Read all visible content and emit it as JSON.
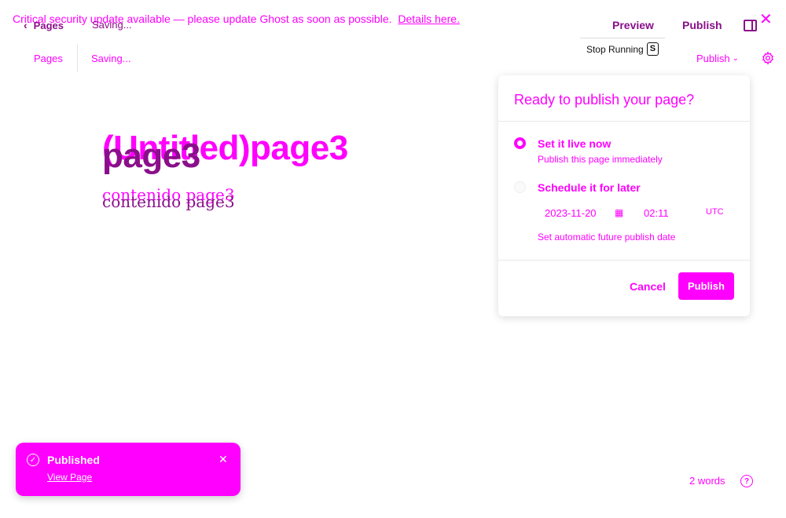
{
  "banner": {
    "text": "Critical security update available — please update Ghost as soon as possible.",
    "link": "Details here."
  },
  "overlay_header": {
    "back_label": "Pages",
    "status": "Saving...",
    "preview": "Preview",
    "publish": "Publish",
    "stop_running": "Stop Running",
    "stop_key": "S"
  },
  "header": {
    "pages_label": "Pages",
    "status": "Saving...",
    "publish_label": "Publish"
  },
  "editor": {
    "title_back": "(Untitled)page3",
    "title_front": "page3",
    "body_back": "contenido page3",
    "body_front": "contenido page3"
  },
  "popover": {
    "title": "Ready to publish your page?",
    "option_now_label": "Set it live now",
    "option_now_sub": "Publish this page immediately",
    "option_later_label": "Schedule it for later",
    "date": "2023-11-20",
    "time": "02:11",
    "tz": "UTC",
    "option_later_sub": "Set automatic future publish date",
    "cancel": "Cancel",
    "publish": "Publish"
  },
  "toast": {
    "title": "Published",
    "link": "View Page"
  },
  "footer": {
    "word_count": "2 words"
  },
  "colors": {
    "accent": "#ff00ff",
    "overlay_text": "#8a0f8a"
  }
}
